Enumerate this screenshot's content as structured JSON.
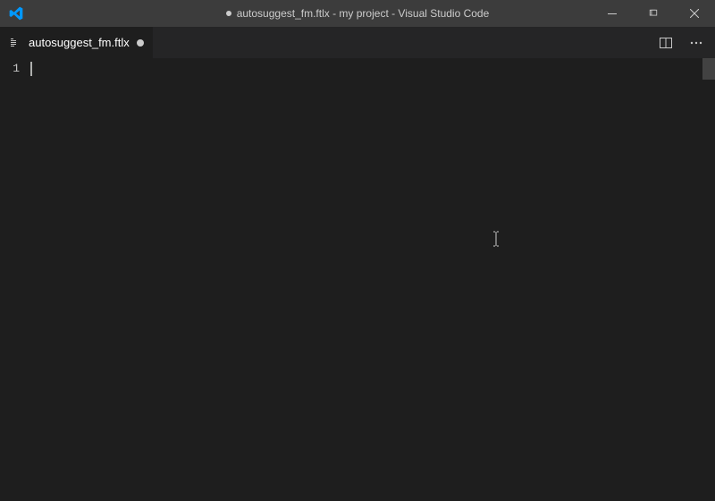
{
  "window": {
    "title_prefix_dirty": true,
    "title": "autosuggest_fm.ftlx - my project - Visual Studio Code"
  },
  "tabs": [
    {
      "label": "autosuggest_fm.ftlx",
      "dirty": true,
      "active": true
    }
  ],
  "editor": {
    "line_numbers": [
      "1"
    ],
    "active_line": 1,
    "content": ""
  },
  "icons": {
    "split_editor": "split-editor-icon",
    "more": "more-icon",
    "file": "file-icon"
  }
}
